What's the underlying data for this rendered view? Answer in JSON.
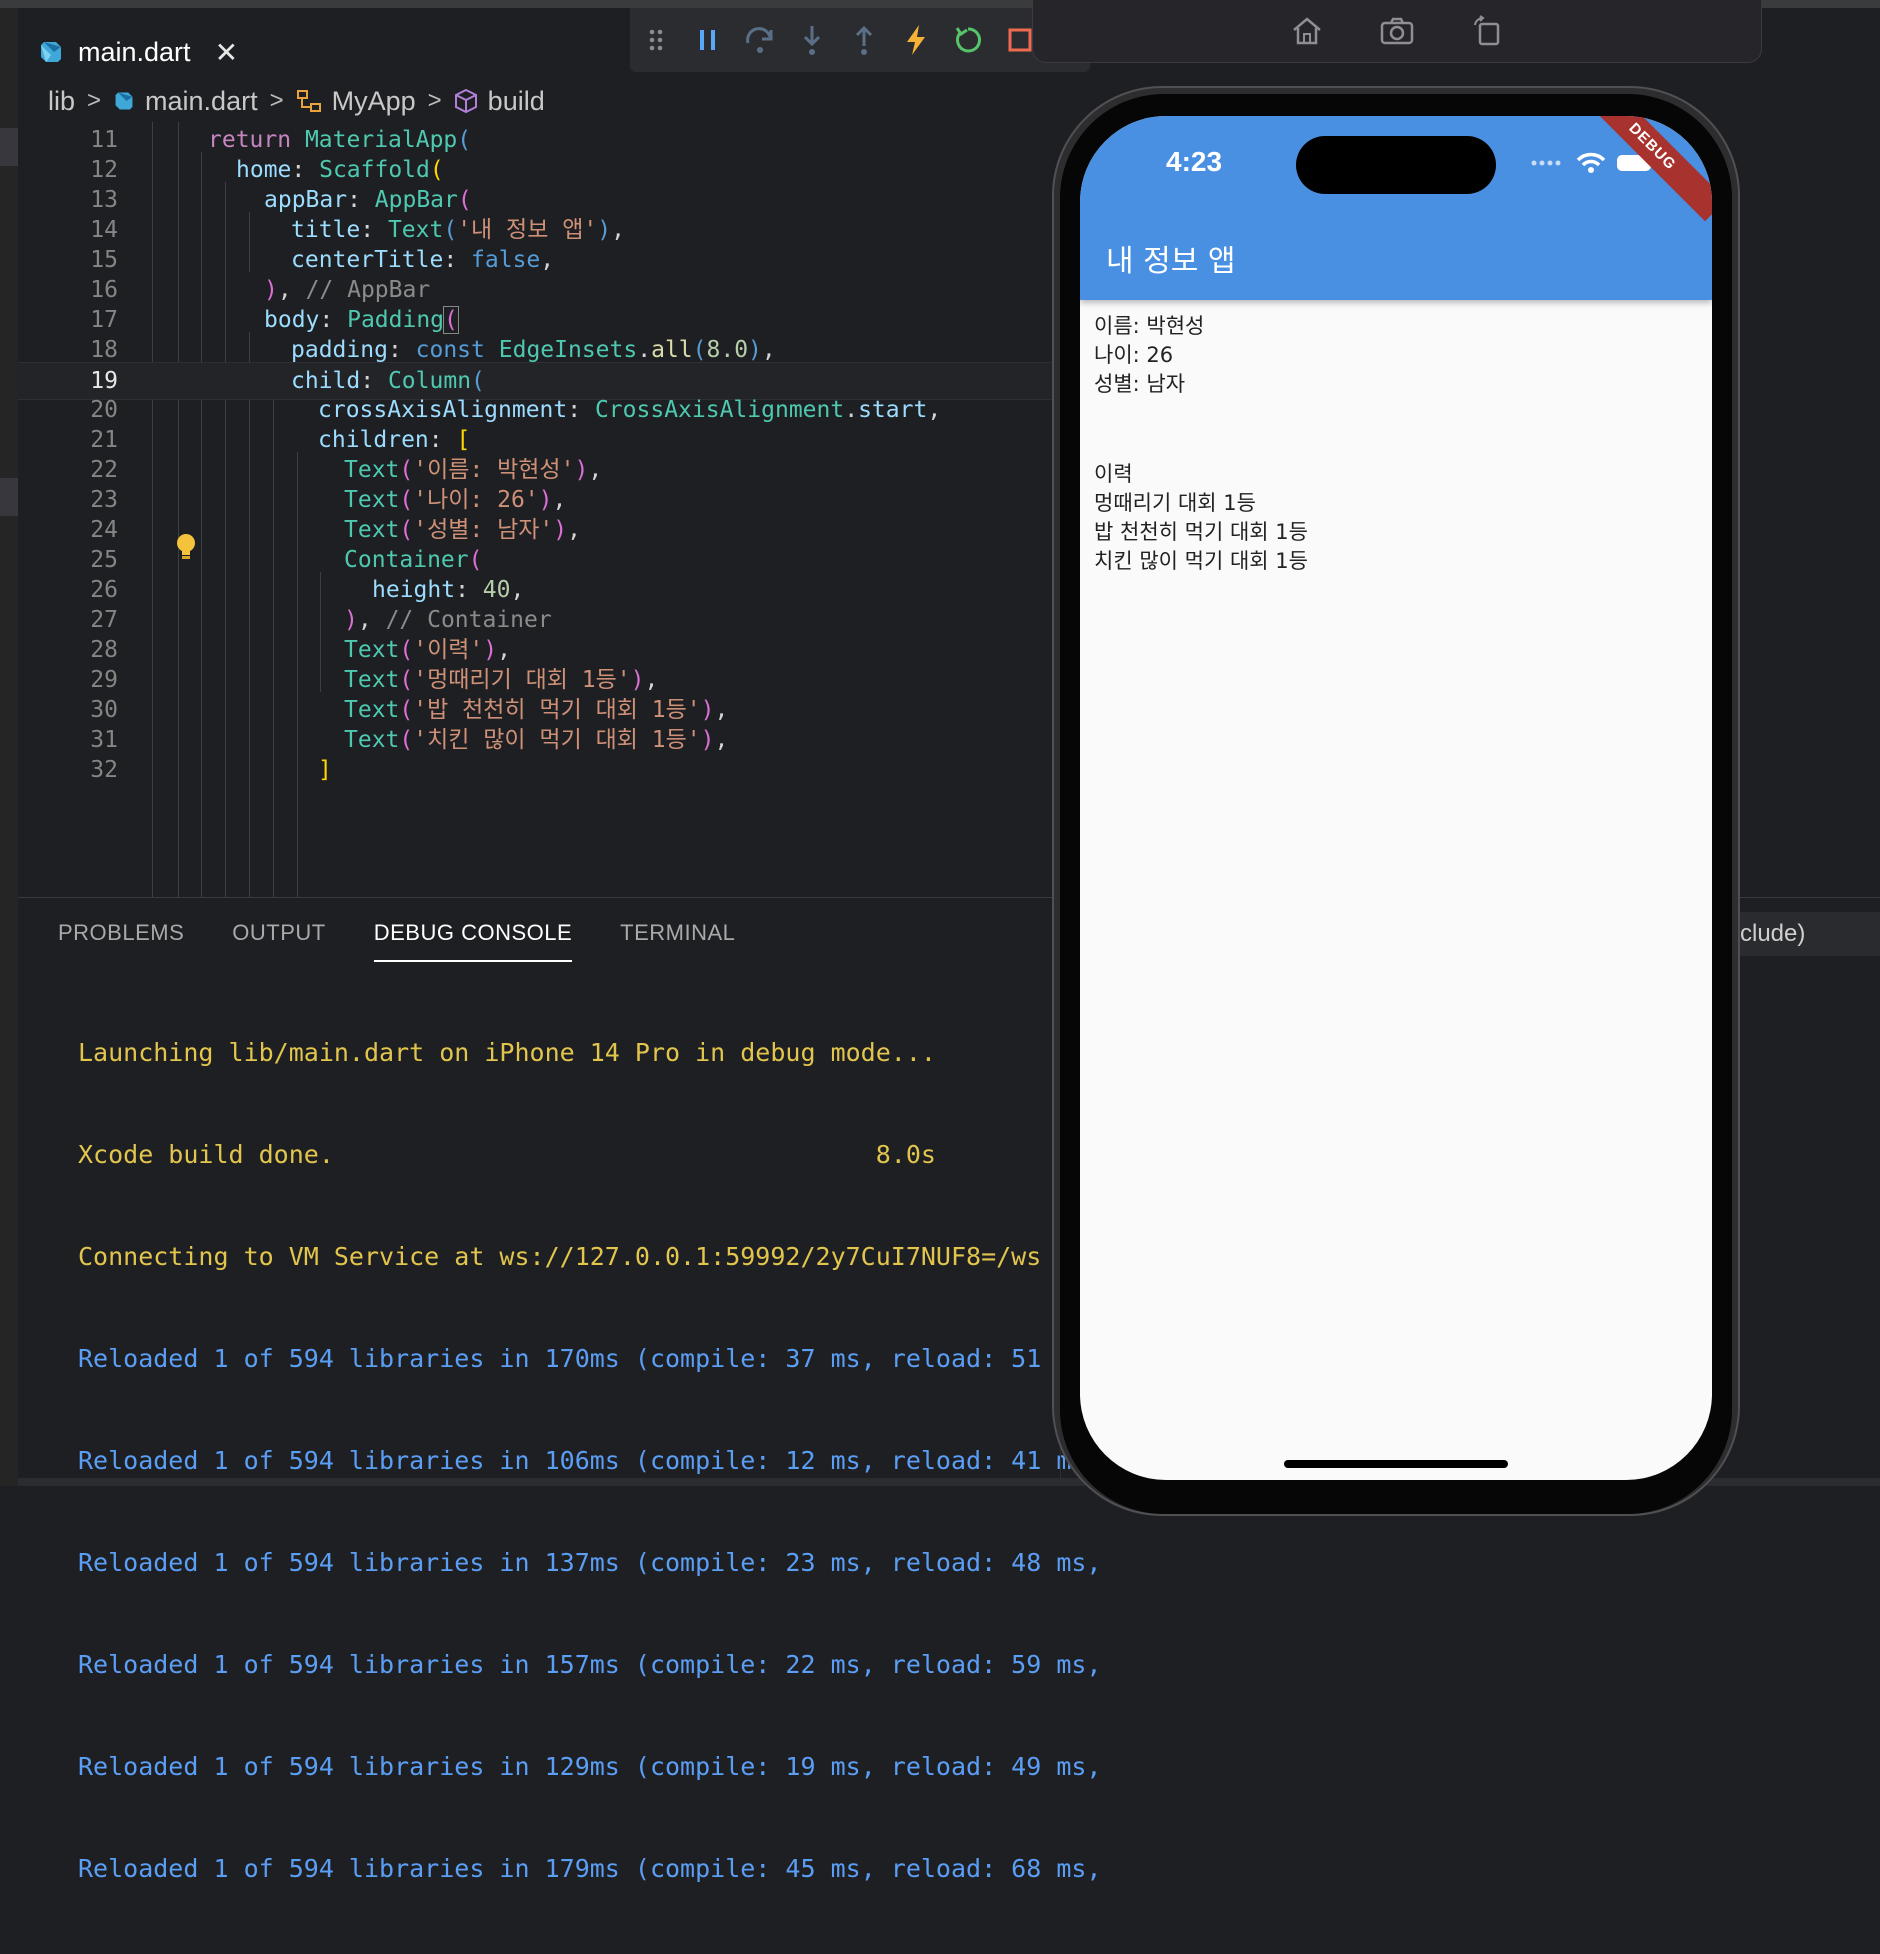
{
  "editor_tab": {
    "label": "main.dart",
    "close": "✕"
  },
  "breadcrumb": {
    "items": [
      "lib",
      "main.dart",
      "MyApp",
      "build"
    ],
    "sep": ">"
  },
  "code": {
    "lines": [
      {
        "n": "11"
      },
      {
        "n": "12"
      },
      {
        "n": "13"
      },
      {
        "n": "14"
      },
      {
        "n": "15"
      },
      {
        "n": "16"
      },
      {
        "n": "17"
      },
      {
        "n": "18"
      },
      {
        "n": "19"
      },
      {
        "n": "20"
      },
      {
        "n": "21"
      },
      {
        "n": "22"
      },
      {
        "n": "23"
      },
      {
        "n": "24"
      },
      {
        "n": "25"
      },
      {
        "n": "26"
      },
      {
        "n": "27"
      },
      {
        "n": "28"
      },
      {
        "n": "29"
      },
      {
        "n": "30"
      },
      {
        "n": "31"
      },
      {
        "n": "32"
      }
    ],
    "current_line": "19"
  },
  "panel": {
    "tabs": [
      "PROBLEMS",
      "OUTPUT",
      "DEBUG CONSOLE",
      "TERMINAL"
    ],
    "active_tab": "DEBUG CONSOLE",
    "console_lines": [
      {
        "text": "Launching lib/main.dart on iPhone 14 Pro in debug mode...",
        "color": "#e2c54d"
      },
      {
        "text": "Xcode build done.                                    8.0s",
        "color": "#e2c54d"
      },
      {
        "text": "Connecting to VM Service at ws://127.0.0.1:59992/2y7CuI7NUF8=/ws",
        "color": "#e2c54d"
      },
      {
        "text": "Reloaded 1 of 594 libraries in 170ms (compile: 37 ms, reload: 51 ms,",
        "color": "#5b9ef5"
      },
      {
        "text": "Reloaded 1 of 594 libraries in 106ms (compile: 12 ms, reload: 41 ms,",
        "color": "#5b9ef5"
      },
      {
        "text": "Reloaded 1 of 594 libraries in 137ms (compile: 23 ms, reload: 48 ms,",
        "color": "#5b9ef5"
      },
      {
        "text": "Reloaded 1 of 594 libraries in 157ms (compile: 22 ms, reload: 59 ms,",
        "color": "#5b9ef5"
      },
      {
        "text": "Reloaded 1 of 594 libraries in 129ms (compile: 19 ms, reload: 49 ms,",
        "color": "#5b9ef5"
      },
      {
        "text": "Reloaded 1 of 594 libraries in 179ms (compile: 45 ms, reload: 68 ms,",
        "color": "#5b9ef5"
      }
    ],
    "filter_text": "clude)"
  },
  "simulator": {
    "buttons": [
      "home-icon",
      "screenshot-icon",
      "rotate-icon"
    ],
    "status_time": "4:23",
    "debug_banner": "DEBUG",
    "app_title": "내 정보 앱",
    "info_lines": [
      "이름: 박현성",
      "나이: 26",
      "성별: 남자"
    ],
    "history_lines": [
      "이력",
      "멍때리기 대회 1등",
      "밥 천천히 먹기 대회 1등",
      "치킨 많이 먹기 대회 1등"
    ],
    "appbar_color": "#4a90e2"
  },
  "debug_toolbar": {
    "buttons": [
      "drag-handle-icon",
      "pause-icon",
      "step-over-icon",
      "step-into-icon",
      "step-out-icon",
      "hot-reload-icon",
      "restart-icon",
      "stop-icon"
    ]
  }
}
